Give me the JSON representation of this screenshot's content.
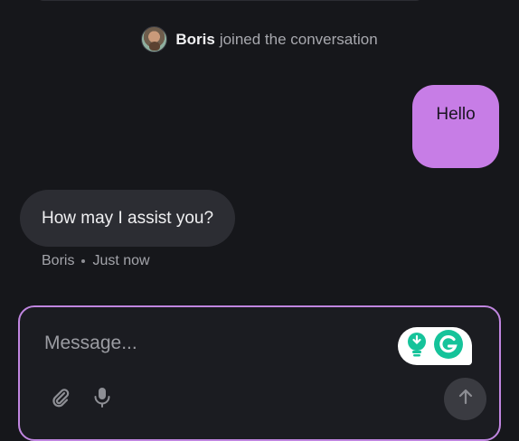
{
  "join_notice": {
    "name": "Boris",
    "text": "joined the conversation"
  },
  "messages": [
    {
      "role": "user",
      "text": "Hello"
    },
    {
      "role": "agent",
      "text": "How may I assist you?"
    }
  ],
  "agent_meta": {
    "name": "Boris",
    "time": "Just now"
  },
  "composer": {
    "placeholder": "Message..."
  },
  "colors": {
    "background": "#16171b",
    "user_bubble": "#c77de6",
    "agent_bubble": "#2c2d33",
    "composer_border": "#c086e0",
    "grammarly_green": "#15c39a"
  },
  "icons": {
    "attach": "paperclip-icon",
    "mic": "microphone-icon",
    "send": "arrow-up-icon",
    "grammarly": "grammarly-icon",
    "suggestion": "lightbulb-icon"
  }
}
